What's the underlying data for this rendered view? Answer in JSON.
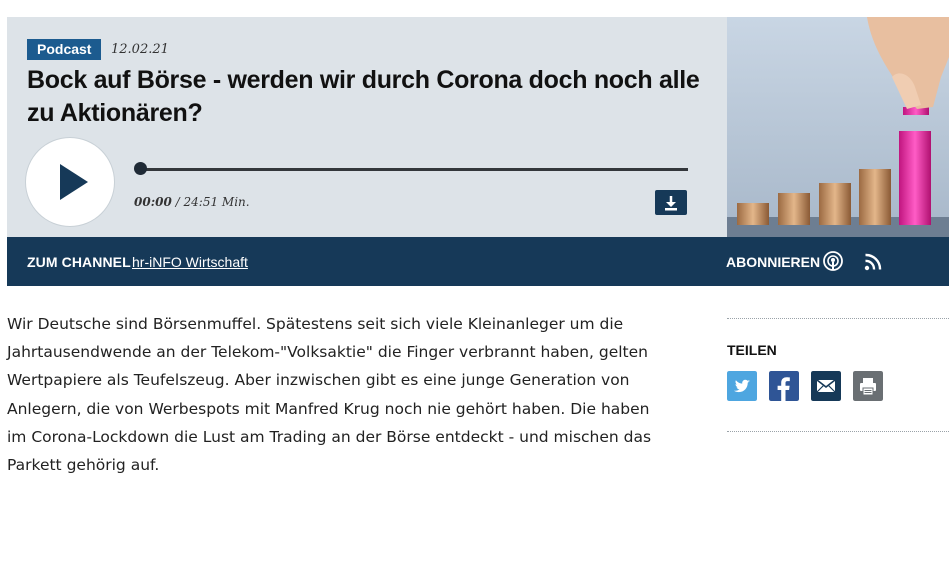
{
  "podcast": {
    "badge": "Podcast",
    "date": "12.02.21",
    "title": "Bock auf Börse - werden wir durch Corona doch noch alle zu Aktionären?",
    "time_current": "00:00",
    "time_separator": "/",
    "time_total": "24:51 Min.",
    "progress": 0
  },
  "channel": {
    "label": "ZUM CHANNEL",
    "link": "hr-iNFO Wirtschaft",
    "subscribe": "ABONNIEREN"
  },
  "article": {
    "text": "Wir Deutsche sind Börsenmuffel. Spätestens seit sich viele Kleinanleger um die Jahrtausendwende an der Telekom-\"Volksaktie\" die Finger verbrannt haben, gelten Wertpapiere als Teufelszeug. Aber inzwischen gibt es eine junge Generation von Anlegern, die von Werbespots mit Manfred Krug noch nie gehört haben. Die haben im Corona-Lockdown die Lust am Trading an der Börse entdeckt - und mischen das Parkett gehörig auf."
  },
  "share": {
    "label": "TEILEN",
    "icons": [
      "twitter-icon",
      "facebook-icon",
      "mail-icon",
      "print-icon"
    ]
  },
  "colors": {
    "badge": "#1c5b8f",
    "channel_bar": "#163958",
    "player_bg": "#dde3e8",
    "twitter": "#4ea6e0",
    "facebook": "#2f5596",
    "mail": "#163958",
    "print": "#6a6f73"
  }
}
